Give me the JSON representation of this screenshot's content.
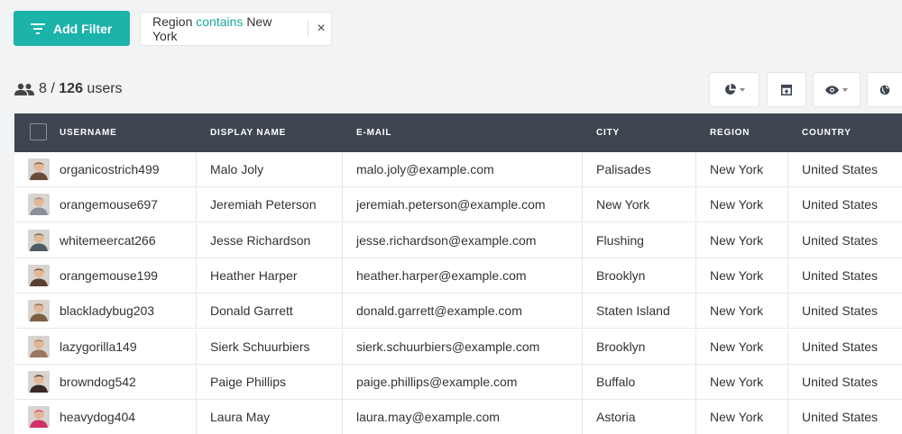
{
  "filter_bar": {
    "add_filter_label": "Add Filter",
    "chip": {
      "field": "Region",
      "operator": "contains",
      "value": "New York",
      "close_glyph": "×"
    }
  },
  "summary": {
    "shown": "8",
    "separator": "/",
    "total": "126",
    "unit": "users"
  },
  "toolbar": {
    "icons": [
      "chart-pie-icon",
      "export-icon",
      "eye-icon",
      "globe-icon"
    ]
  },
  "table": {
    "headers": [
      "USERNAME",
      "DISPLAY NAME",
      "E-MAIL",
      "CITY",
      "REGION",
      "COUNTRY"
    ],
    "rows": [
      {
        "username": "organicostrich499",
        "display": "Malo Joly",
        "email": "malo.joly@example.com",
        "city": "Palisades",
        "region": "New York",
        "country": "United States",
        "avatar_color": "#6b4b3a"
      },
      {
        "username": "orangemouse697",
        "display": "Jeremiah Peterson",
        "email": "jeremiah.peterson@example.com",
        "city": "New York",
        "region": "New York",
        "country": "United States",
        "avatar_color": "#8a8f98"
      },
      {
        "username": "whitemeercat266",
        "display": "Jesse Richardson",
        "email": "jesse.richardson@example.com",
        "city": "Flushing",
        "region": "New York",
        "country": "United States",
        "avatar_color": "#4e5a63"
      },
      {
        "username": "orangemouse199",
        "display": "Heather Harper",
        "email": "heather.harper@example.com",
        "city": "Brooklyn",
        "region": "New York",
        "country": "United States",
        "avatar_color": "#5a3f33"
      },
      {
        "username": "blackladybug203",
        "display": "Donald Garrett",
        "email": "donald.garrett@example.com",
        "city": "Staten Island",
        "region": "New York",
        "country": "United States",
        "avatar_color": "#7a6040"
      },
      {
        "username": "lazygorilla149",
        "display": "Sierk Schuurbiers",
        "email": "sierk.schuurbiers@example.com",
        "city": "Brooklyn",
        "region": "New York",
        "country": "United States",
        "avatar_color": "#9a7660"
      },
      {
        "username": "browndog542",
        "display": "Paige Phillips",
        "email": "paige.phillips@example.com",
        "city": "Buffalo",
        "region": "New York",
        "country": "United States",
        "avatar_color": "#3a2a24"
      },
      {
        "username": "heavydog404",
        "display": "Laura May",
        "email": "laura.may@example.com",
        "city": "Astoria",
        "region": "New York",
        "country": "United States",
        "avatar_color": "#d0306a"
      }
    ]
  },
  "colors": {
    "accent": "#1bb3aa",
    "header_bg": "#3d4550",
    "page_bg": "#f2f3f5"
  }
}
